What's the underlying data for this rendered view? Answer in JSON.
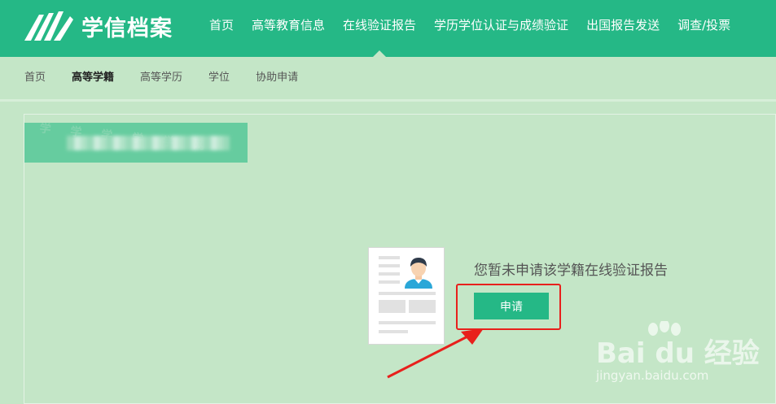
{
  "header": {
    "logo_text": "学信档案",
    "nav": [
      "首页",
      "高等教育信息",
      "在线验证报告",
      "学历学位认证与成绩验证",
      "出国报告发送",
      "调查/投票"
    ],
    "active_index": 2
  },
  "subnav": {
    "items": [
      "首页",
      "高等学籍",
      "高等学历",
      "学位",
      "协助申请"
    ],
    "active_index": 1
  },
  "main": {
    "empty_message": "您暂未申请该学籍在线验证报告",
    "apply_label": "申请"
  },
  "watermark": {
    "brand": "Bai du 经验",
    "url": "jingyan.baidu.com"
  },
  "colors": {
    "header_bg": "#25b886",
    "page_bg": "#c4e6c7",
    "button_bg": "#25b886",
    "highlight": "#e8201c"
  }
}
